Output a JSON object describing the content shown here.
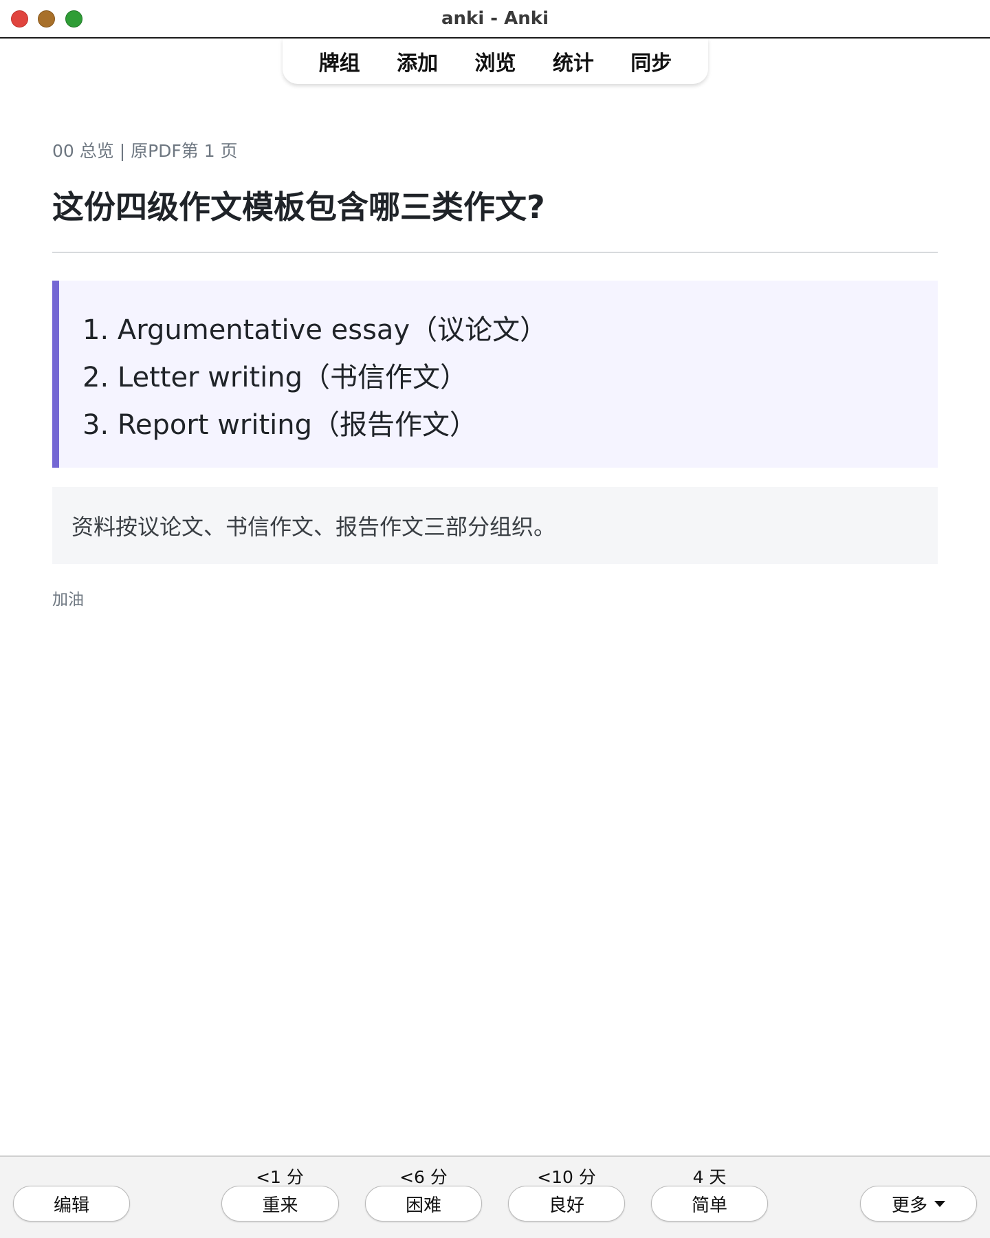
{
  "window": {
    "title": "anki - Anki"
  },
  "topnav": {
    "items": [
      {
        "label": "牌组"
      },
      {
        "label": "添加"
      },
      {
        "label": "浏览"
      },
      {
        "label": "统计"
      },
      {
        "label": "同步"
      }
    ]
  },
  "card": {
    "meta": "00 总览 | 原PDF第 1 页",
    "question": "这份四级作文模板包含哪三类作文?",
    "answers": [
      "1. Argumentative essay（议论文）",
      "2. Letter writing（书信作文）",
      "3. Report writing（报告作文）"
    ],
    "note": "资料按议论文、书信作文、报告作文三部分组织。",
    "tag": "加油"
  },
  "bottombar": {
    "edit_label": "编辑",
    "more_label": "更多",
    "answers": [
      {
        "interval": "<1 分",
        "label": "重来"
      },
      {
        "interval": "<6 分",
        "label": "困难"
      },
      {
        "interval": "<10 分",
        "label": "良好"
      },
      {
        "interval": "4 天",
        "label": "简单"
      }
    ]
  }
}
